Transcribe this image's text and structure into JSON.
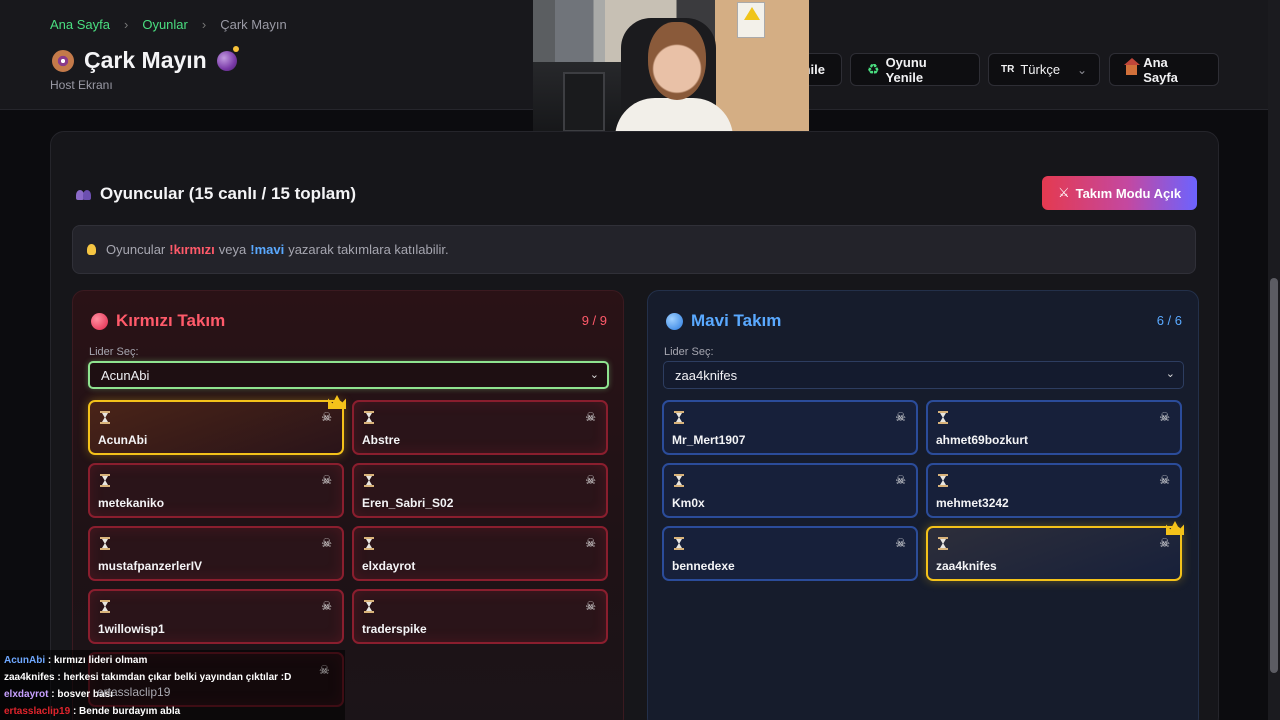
{
  "breadcrumb": {
    "home": "Ana Sayfa",
    "games": "Oyunlar",
    "current": "Çark Mayın",
    "sep": "›"
  },
  "header": {
    "title": "Çark Mayın",
    "subtitle": "Host Ekranı"
  },
  "buttons": {
    "partial_label": "nile",
    "restart_label": "Oyunu Yenile",
    "restart_icon": "♻",
    "language_flag": "TR",
    "language_value": "Türkçe",
    "home_label": "Ana Sayfa"
  },
  "players": {
    "title": "Oyuncular (15 canlı / 15 toplam)",
    "team_mode_label": "Takım Modu Açık",
    "hint_prefix": "Oyuncular",
    "hint_red": "!kırmızı",
    "hint_middle": "veya",
    "hint_blue": "!mavi",
    "hint_suffix": "yazarak takımlara katılabilir."
  },
  "red_team": {
    "name": "Kırmızı Takım",
    "count": "9 / 9",
    "leader_label": "Lider Seç:",
    "leader_value": "AcunAbi",
    "players": [
      "AcunAbi",
      "Abstre",
      "metekaniko",
      "Eren_Sabri_S02",
      "mustafpanzerlerIV",
      "elxdayrot",
      "1willowisp1",
      "traderspike"
    ]
  },
  "blue_team": {
    "name": "Mavi Takım",
    "count": "6 / 6",
    "leader_label": "Lider Seç:",
    "leader_value": "zaa4knifes",
    "players": [
      "Mr_Mert1907",
      "ahmet69bozkurt",
      "Km0x",
      "mehmet3242",
      "bennedexe",
      "zaa4knifes"
    ]
  },
  "chat": [
    {
      "user": "AcunAbi",
      "message": " : kırmızı lideri olmam"
    },
    {
      "user": "zaa4knifes",
      "message": " : herkesi takımdan çıkar belki yayından çıktılar :D"
    },
    {
      "user": "elxdayrot",
      "message": " : bosver bası"
    },
    {
      "user": "ertasslaclip19",
      "message": " : Bende burdayım abla"
    }
  ],
  "ghost_player": "ertasslaclip19",
  "colors": {
    "accent_green": "#4ade80",
    "red": "#ff5a6a",
    "blue": "#5aa9ff",
    "leader_gold": "#f4c21a"
  }
}
